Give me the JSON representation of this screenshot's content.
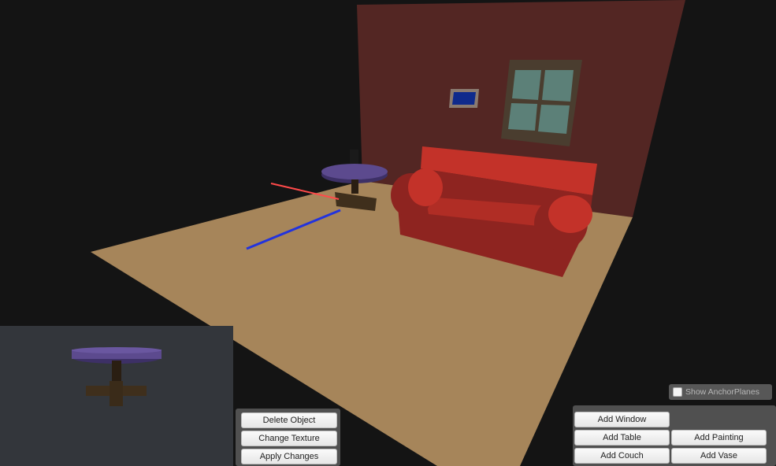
{
  "scene": {
    "colors": {
      "background": "#141414",
      "floor": "#a6855a",
      "wall": "#532623",
      "couch": "#8e2420",
      "couch_top": "#c33229",
      "table_top": "#5c4a8e",
      "table_base": "#3f2f1c",
      "window_frame": "#4a3d2f",
      "window_glass": "#5c8078",
      "painting_frame": "#8a7a70",
      "painting_canvas": "#0f2a8c",
      "axis_x": "#ff4a4a",
      "axis_z": "#2233dd"
    }
  },
  "preview": {
    "object": "table"
  },
  "object_actions": {
    "delete_label": "Delete Object",
    "change_texture_label": "Change Texture",
    "apply_changes_label": "Apply Changes"
  },
  "add_panel": {
    "add_window_label": "Add Window",
    "add_table_label": "Add Table",
    "add_painting_label": "Add Painting",
    "add_couch_label": "Add Couch",
    "add_vase_label": "Add Vase"
  },
  "anchor_toggle": {
    "label": "Show AnchorPlanes",
    "checked": false
  }
}
